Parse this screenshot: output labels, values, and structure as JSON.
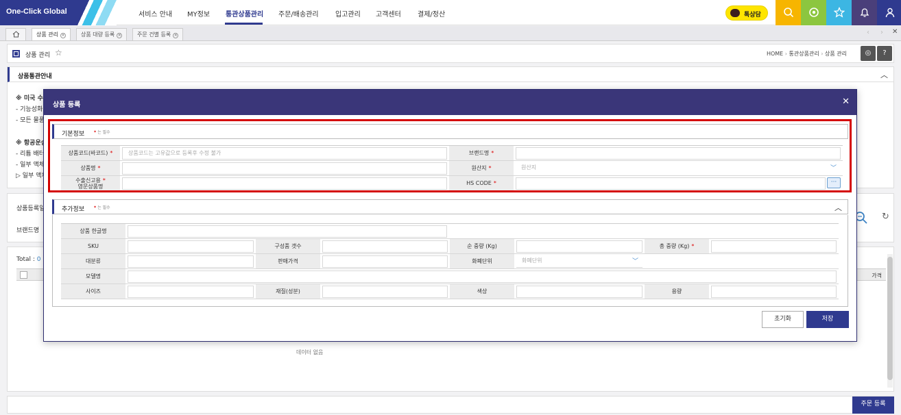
{
  "brand": {
    "logo_text": "One-Click Global"
  },
  "nav": [
    {
      "label": "서비스 안내"
    },
    {
      "label": "MY정보"
    },
    {
      "label": "통관상품관리"
    },
    {
      "label": "주문/배송관리"
    },
    {
      "label": "입고관리"
    },
    {
      "label": "고객센터"
    },
    {
      "label": "결제/정산"
    }
  ],
  "header": {
    "talk_label": "톡상담"
  },
  "tabs": [
    {
      "label": "상품 관리"
    },
    {
      "label": "상품 대량 등록"
    },
    {
      "label": "주문 건별 등록"
    }
  ],
  "page": {
    "title": "상품 관리",
    "breadcrumb": [
      "HOME",
      "통관상품관리",
      "상품 관리"
    ]
  },
  "panel_notice": {
    "title": "상품통관안내",
    "lines": [
      "※ 미국 수",
      "- 기능성화",
      "- 모든 물품",
      "※ 항공운송",
      "- 리튬 배터",
      "- 일부 액체",
      "▷ 일부 액체"
    ]
  },
  "panel_search": {
    "title": "상품등록일",
    "brand_label": "브랜드명"
  },
  "panel_list": {
    "total_label": "Total : ",
    "total_value": "0",
    "col_price": "가격",
    "empty_text": "데이터 없음"
  },
  "bottom": {
    "order_button": "주문 등록"
  },
  "modal": {
    "title": "상품 등록",
    "close": "✕",
    "required_note_prefix": "* ",
    "required_note_suffix": "는 필수",
    "basic": {
      "title": "기본정보",
      "fields": {
        "product_code_label": "상품코드(바코드)",
        "product_code_placeholder": "상품코드는 고유값으로 등록후 수정 불가",
        "brand_label": "브랜드명",
        "product_name_label": "상품명",
        "origin_label": "원산지",
        "origin_placeholder": "원산지",
        "export_name_label_1": "수출신고용",
        "export_name_label_2": "영문상품명",
        "hs_code_label": "HS CODE"
      }
    },
    "extra": {
      "title": "추가정보",
      "fields": {
        "korean_name_label": "상품 한글명",
        "sku_label": "SKU",
        "components_label": "구성품 갯수",
        "net_weight_label": "순 중량 (Kg)",
        "gross_weight_label": "총 중량 (Kg)",
        "category_label": "대분류",
        "price_label": "판매가격",
        "currency_label": "화폐단위",
        "currency_placeholder": "화폐단위",
        "model_label": "모델명",
        "size_label": "사이즈",
        "material_label": "재질(성분)",
        "color_label": "색상",
        "capacity_label": "용량"
      }
    },
    "reset_button": "초기화",
    "save_button": "저장"
  },
  "colors": {
    "brand": "#2f3a8f",
    "modal_header": "#3a3679",
    "required": "#d40000"
  }
}
